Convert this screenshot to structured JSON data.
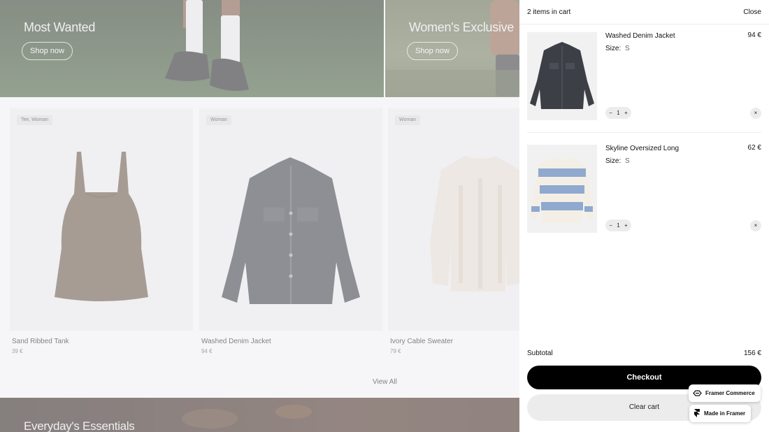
{
  "hero": {
    "left": {
      "title": "Most Wanted",
      "button": "Shop now"
    },
    "right": {
      "title": "Women's Exclusive",
      "button": "Shop now"
    }
  },
  "products": [
    {
      "tag": "Tee, Woman",
      "name": "Sand Ribbed Tank",
      "price": "39 €"
    },
    {
      "tag": "Woman",
      "name": "Washed Denim Jacket",
      "price": "94 €"
    },
    {
      "tag": "Woman",
      "name": "Ivory Cable Sweater",
      "price": "79 €"
    }
  ],
  "view_all": "View All",
  "bottom_banner": {
    "title": "Everyday's Essentials"
  },
  "cart": {
    "count_label": "2 items in cart",
    "close_label": "Close",
    "size_label": "Size:",
    "items": [
      {
        "name": "Washed Denim Jacket",
        "size": "S",
        "price": "94 €",
        "quantity": "1",
        "minus": "−",
        "plus": "+",
        "remove": "×"
      },
      {
        "name": "Skyline Oversized Long",
        "size": "S",
        "price": "62 €",
        "quantity": "1",
        "minus": "−",
        "plus": "+",
        "remove": "×"
      }
    ],
    "subtotal_label": "Subtotal",
    "subtotal_value": "156 €",
    "checkout_label": "Checkout",
    "clear_label": "Clear cart"
  },
  "badges": {
    "commerce": "Framer Commerce",
    "made_in": "Made in Framer"
  },
  "colors": {
    "accent": "#000000",
    "overlay": "#eeeef2",
    "denim": "#3c3f45",
    "stripe_blue": "#8fa9cf"
  }
}
